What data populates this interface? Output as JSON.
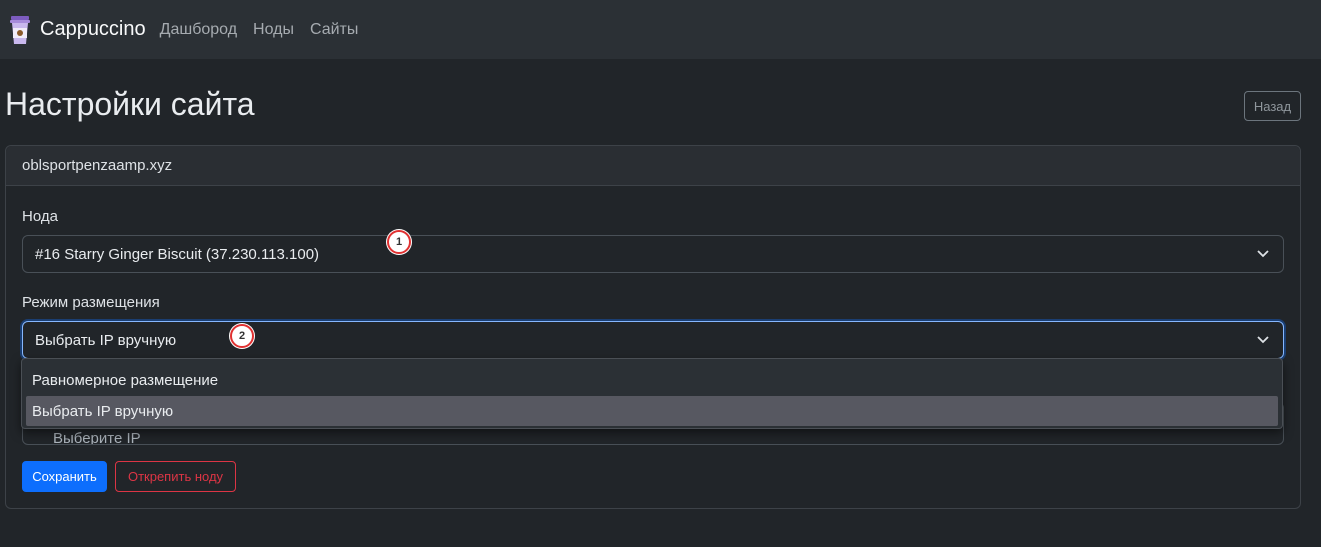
{
  "navbar": {
    "brand": "Cappuccino",
    "brand_icon": "coffee-cup-icon",
    "links": [
      "Дашбород",
      "Ноды",
      "Сайты"
    ]
  },
  "page": {
    "title": "Настройки сайта",
    "back_label": "Назад"
  },
  "card": {
    "header": "oblsportpenzaamp.xyz",
    "node_label": "Нода",
    "node_value": "#16 Starry Ginger Biscuit (37.230.113.100)",
    "mode_label": "Режим размещения",
    "mode_value": "Выбрать IP вручную",
    "hidden_partial": "Выберите IP",
    "dropdown_options": [
      "Равномерное размещение",
      "Выбрать IP вручную"
    ],
    "selected_option_index": 1
  },
  "markers": [
    "1",
    "2"
  ],
  "buttons": {
    "save": "Сохранить",
    "detach": "Открепить ноду"
  },
  "colors": {
    "primary": "#0d6efd",
    "danger": "#dc3545",
    "marker_ring": "#e03131"
  }
}
